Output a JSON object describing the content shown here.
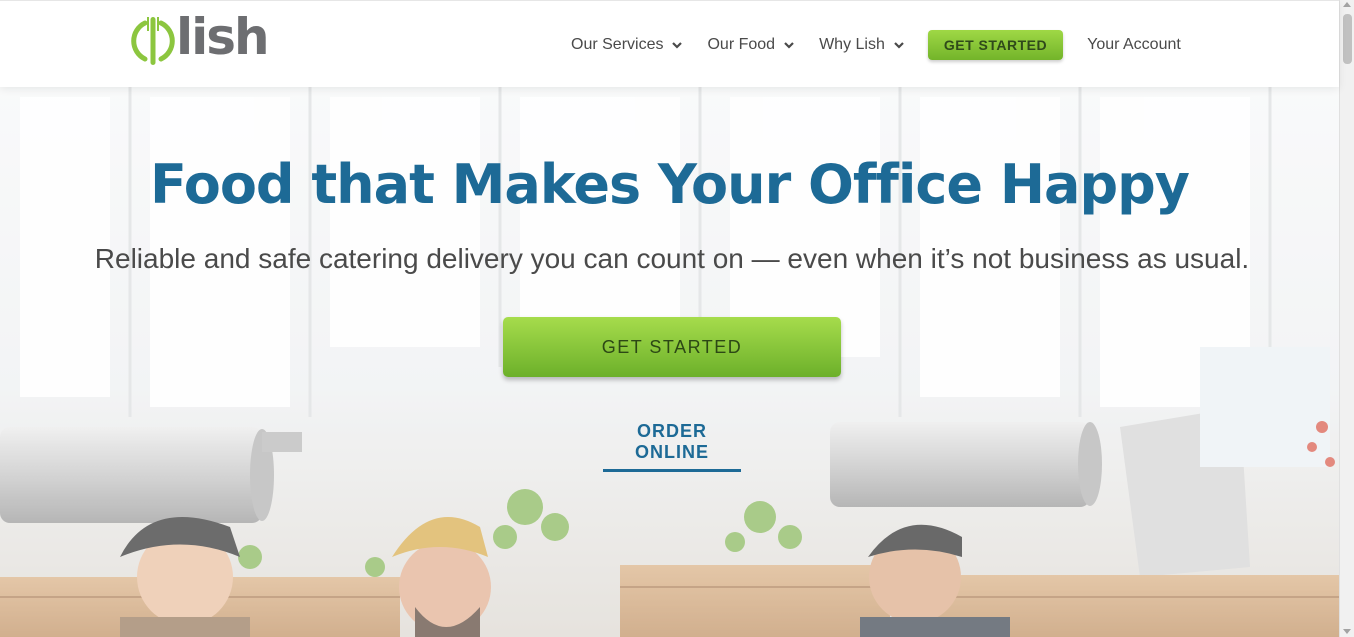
{
  "brand": {
    "name": "lish",
    "colors": {
      "green": "#8cc63f",
      "blue": "#1d6a96",
      "gray": "#6d6e71"
    }
  },
  "nav": {
    "items": [
      {
        "label": "Our Services",
        "icon": "chevron-down-icon"
      },
      {
        "label": "Our Food",
        "icon": "chevron-down-icon"
      },
      {
        "label": "Why Lish",
        "icon": "chevron-down-icon"
      }
    ],
    "cta_label": "GET STARTED",
    "account_label": "Your Account"
  },
  "hero": {
    "title": "Food that Makes Your Office Happy",
    "subtitle": "Reliable and safe catering delivery you can count on — even when it’s not business as usual.",
    "cta_label": "GET STARTED",
    "order_link": "ORDER ONLINE"
  }
}
